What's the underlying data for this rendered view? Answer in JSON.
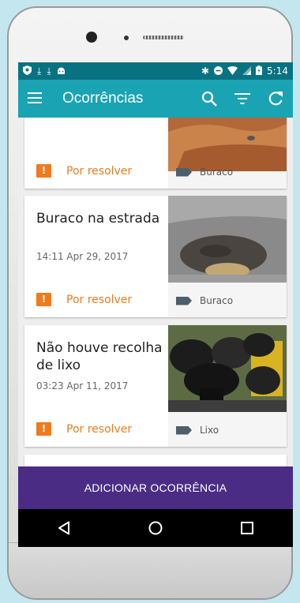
{
  "statusbar": {
    "time": "5:14"
  },
  "appbar": {
    "title": "Ocorrências",
    "icons": [
      "menu-icon",
      "search-icon",
      "filter-icon",
      "refresh-icon"
    ]
  },
  "occurrences": [
    {
      "title": "",
      "time": "",
      "status": "Por resolver",
      "category": "Buraco"
    },
    {
      "title": "Buraco na estrada",
      "time": "14:11  Apr 29, 2017",
      "status": "Por resolver",
      "category": "Buraco"
    },
    {
      "title": "Não houve recolha de lixo",
      "time": "03:23  Apr 11, 2017",
      "status": "Por resolver",
      "category": "Lixo"
    }
  ],
  "add_button": "ADICIONAR OCORRÊNCIA",
  "colors": {
    "primary": "#1aa3b3",
    "status_bar": "#097282",
    "accent": "#f07a1c",
    "button": "#4b2c85"
  }
}
